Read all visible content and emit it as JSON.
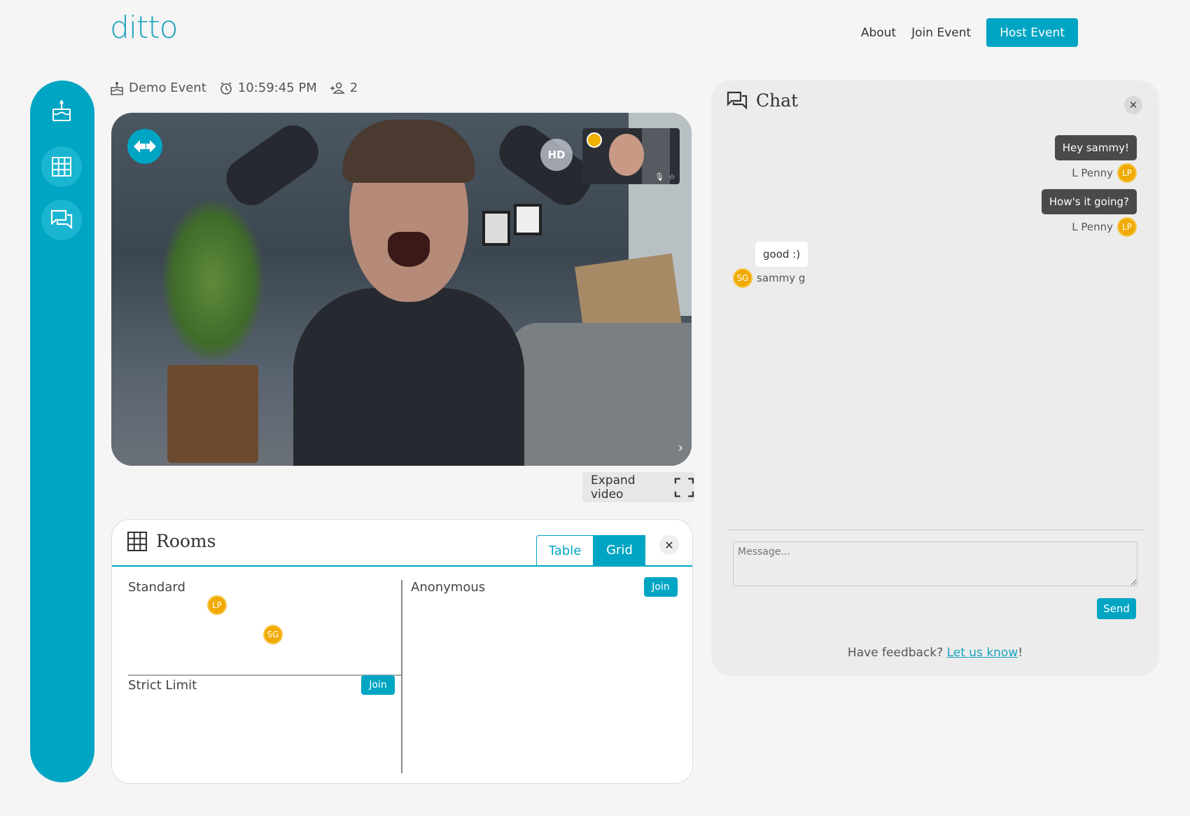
{
  "brand": {
    "name": "ditto",
    "accent": "#00a5c3"
  },
  "nav": {
    "about": "About",
    "join": "Join Event",
    "host": "Host Event"
  },
  "sidebar": {
    "items": [
      {
        "icon": "cake-icon"
      },
      {
        "icon": "grid-icon"
      },
      {
        "icon": "chat-icon"
      }
    ]
  },
  "event": {
    "name": "Demo Event",
    "time": "10:59:45 PM",
    "attendees": "2"
  },
  "video": {
    "hd": "HD",
    "expand_label": "Expand video"
  },
  "rooms": {
    "title": "Rooms",
    "view_table": "Table",
    "view_grid": "Grid",
    "close": "✕",
    "list": [
      {
        "name": "Standard",
        "avatars": [
          "LP",
          "SG"
        ]
      },
      {
        "name": "Anonymous",
        "join": "Join"
      },
      {
        "name": "Strict Limit",
        "join": "Join"
      }
    ]
  },
  "chat": {
    "title": "Chat",
    "close": "✕",
    "messages": [
      {
        "text": "Hey sammy!",
        "author": "L Penny",
        "initials": "LP"
      },
      {
        "text": "How's it going?",
        "author": "L Penny",
        "initials": "LP"
      },
      {
        "text": "good :)",
        "author": "sammy g",
        "initials": "SG"
      }
    ],
    "input_placeholder": "Message...",
    "send": "Send",
    "feedback_prefix": "Have feedback? ",
    "feedback_link": "Let us know",
    "feedback_suffix": "!"
  }
}
